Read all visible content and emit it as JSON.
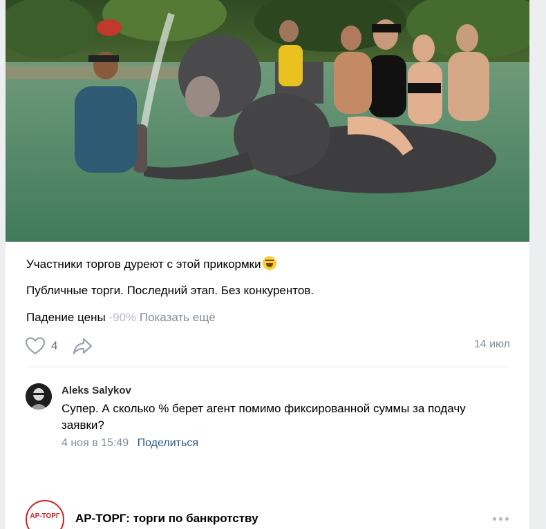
{
  "post": {
    "image_alt": "Люди купаются со слонами в реке",
    "text_line1": "Участники торгов дуреют с этой прикормки",
    "text_line2": "Публичные торги. Последний этап. Без конкурентов.",
    "text_line3_main": "Падение цены ",
    "text_line3_faded": "-90%",
    "show_more": "Показать ещё",
    "likes": "4",
    "date": "14 июл",
    "emoji_icon": "laughing-face-icon"
  },
  "comment": {
    "author": "Aleks Salykov",
    "text": "Супер. А сколько % берет агент помимо фиксированной суммы за подачу заявки?",
    "date": "4 ноя в 15:49",
    "share_label": "Поделиться"
  },
  "next_post": {
    "logo_text": "АР-ТОРГ",
    "title": "АР-ТОРГ: торги по банкротству"
  },
  "colors": {
    "link": "#2a5885",
    "muted": "#818c99",
    "divider": "#e7e8ec"
  }
}
